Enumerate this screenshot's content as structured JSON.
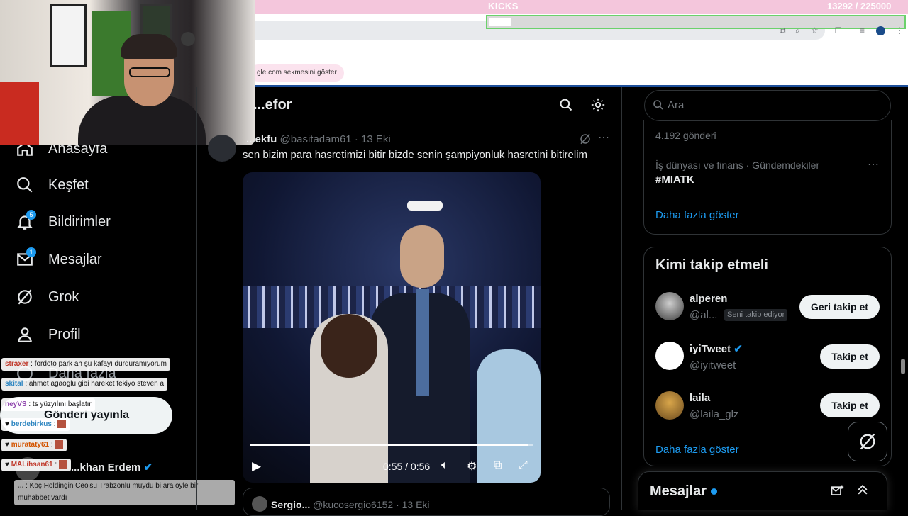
{
  "stream": {
    "kicks_label": "KICKS",
    "kicks_count": "13292",
    "kicks_goal": "/ 225000",
    "goal_progress": 0.06
  },
  "browser": {
    "google_tab_label": "gle.com sekmesini göster"
  },
  "nav": {
    "items": [
      {
        "label": "Anasayfa",
        "icon": "home-icon"
      },
      {
        "label": "Keşfet",
        "icon": "search-icon"
      },
      {
        "label": "Bildirimler",
        "icon": "bell-icon",
        "badge": "5"
      },
      {
        "label": "Mesajlar",
        "icon": "mail-icon",
        "badge": "1"
      },
      {
        "label": "Grok",
        "icon": "grok-icon"
      },
      {
        "label": "Profil",
        "icon": "person-icon"
      },
      {
        "label": "Daha fazla",
        "icon": "more-icon"
      }
    ],
    "post_button": "Gönderi yayınla",
    "account_name": "...khan Erdem"
  },
  "chat": [
    {
      "user": "straxer",
      "msg": ": fordoto park ah şu kafayı durduramıyorum",
      "color": "#c0392b"
    },
    {
      "user": "skital",
      "msg": ": ahmet agaoglu gibi hareket fekiyo steven a",
      "color": "#2e86c1"
    },
    {
      "user": "neyVS",
      "msg": ": ts yüzyılını başlatır",
      "color": "#8e44ad"
    },
    {
      "user": "berdebirkus",
      "msg": ":",
      "color": "#2e86c1"
    },
    {
      "user": "murataty61",
      "msg": ":",
      "color": "#d35400"
    },
    {
      "user": "MALihsan61",
      "msg": ":",
      "color": "#c0392b"
    },
    {
      "user": "...",
      "msg": ": Koç Holdingin Ceo'su Trabzonlu muydu bi ara öyle bir muhabbet vardı",
      "color": "#555"
    }
  ],
  "timeline": {
    "header": "...efor",
    "tweet": {
      "name": "...ekfu",
      "handle": "@basitadam61",
      "date": "· 13 Eki",
      "text": "sen bizim para hasretimizi bitir bizde senin şampiyonluk hasretini bitirelim"
    },
    "video": {
      "time": "0:55 / 0:56",
      "progress": 0.98
    },
    "next": {
      "name": "Sergio...",
      "handle": "@kucosergio6152",
      "date": "· 13 Eki"
    }
  },
  "sidebar": {
    "search_placeholder": "Ara",
    "trend_count": "4.192 gönderi",
    "trend_category": "İş dünyası ve finans · Gündemdekiler",
    "trend_name": "#MIATK",
    "show_more": "Daha fazla göster",
    "who_title": "Kimi takip etmeli",
    "who": [
      {
        "name": "alperen",
        "handle": "@al...",
        "note": "Seni takip ediyor",
        "button": "Geri takip et",
        "verified": false
      },
      {
        "name": "iyiTweet",
        "handle": "@iyitweet",
        "note": "",
        "button": "Takip et",
        "verified": true
      },
      {
        "name": "laila",
        "handle": "@laila_glz",
        "note": "",
        "button": "Takip et",
        "verified": false
      }
    ],
    "who_more": "Daha fazla göster",
    "messages_title": "Mesajlar"
  },
  "colors": {
    "accent": "#1d9bf0",
    "bg": "#000000",
    "border": "#2f3336",
    "muted": "#71767b"
  }
}
